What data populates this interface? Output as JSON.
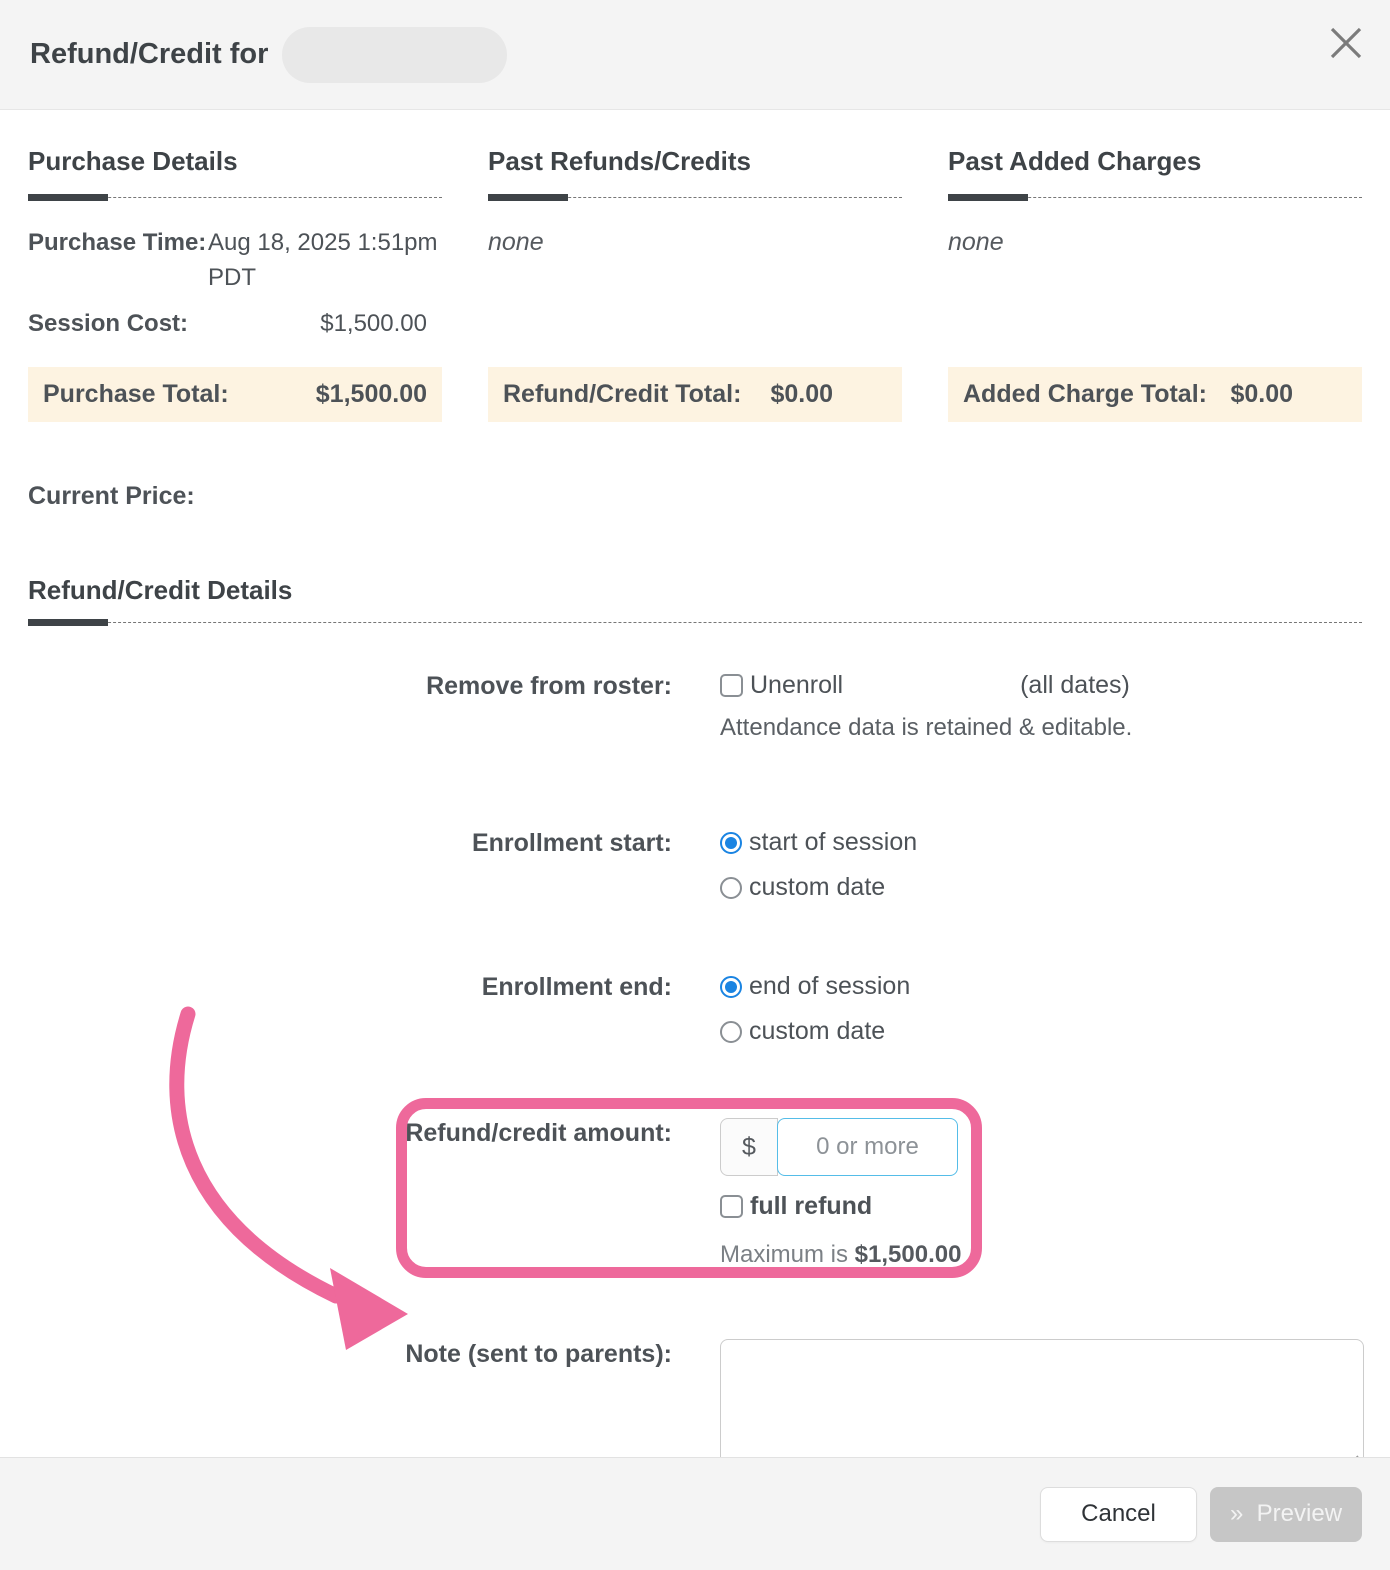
{
  "header": {
    "title": "Refund/Credit for"
  },
  "icons": {
    "close": "x-cross",
    "preview_chevron": "»",
    "resize_handle": "diagonal-grip"
  },
  "colors": {
    "accent_pink": "#ee699b",
    "highlight_cream": "#fdf3e1",
    "radio_blue": "#1a84e2",
    "input_border_blue": "#55bde8",
    "header_bg": "#f4f4f4"
  },
  "summary": {
    "purchase": {
      "heading": "Purchase Details",
      "time_label": "Purchase Time:",
      "time_value": "Aug 18, 2025 1:51pm PDT",
      "cost_label": "Session Cost:",
      "cost_value": "$1,500.00",
      "total_label": "Purchase Total:",
      "total_value": "$1,500.00"
    },
    "refunds": {
      "heading": "Past Refunds/Credits",
      "empty": "none",
      "total_label": "Refund/Credit Total:",
      "total_value": "$0.00"
    },
    "charges": {
      "heading": "Past Added Charges",
      "empty": "none",
      "total_label": "Added Charge Total:",
      "total_value": "$0.00"
    },
    "current_price_label": "Current Price:"
  },
  "details": {
    "heading": "Refund/Credit Details",
    "remove_row": {
      "label": "Remove from roster:",
      "checkbox_label": "Unenroll",
      "all_dates": "(all dates)",
      "helper": "Attendance data is retained & editable."
    },
    "enrollment_start": {
      "label": "Enrollment start:",
      "option_session": "start of session",
      "option_custom": "custom date"
    },
    "enrollment_end": {
      "label": "Enrollment end:",
      "option_session": "end of session",
      "option_custom": "custom date"
    },
    "amount_row": {
      "label": "Refund/credit amount:",
      "currency": "$",
      "placeholder": "0 or more",
      "full_refund_label": "full refund",
      "maximum_prefix": "Maximum is ",
      "maximum_value": "$1,500.00"
    },
    "note_row": {
      "label": "Note (sent to parents):"
    }
  },
  "footer": {
    "cancel_label": "Cancel",
    "preview_icon": "»",
    "preview_label": "Preview"
  }
}
